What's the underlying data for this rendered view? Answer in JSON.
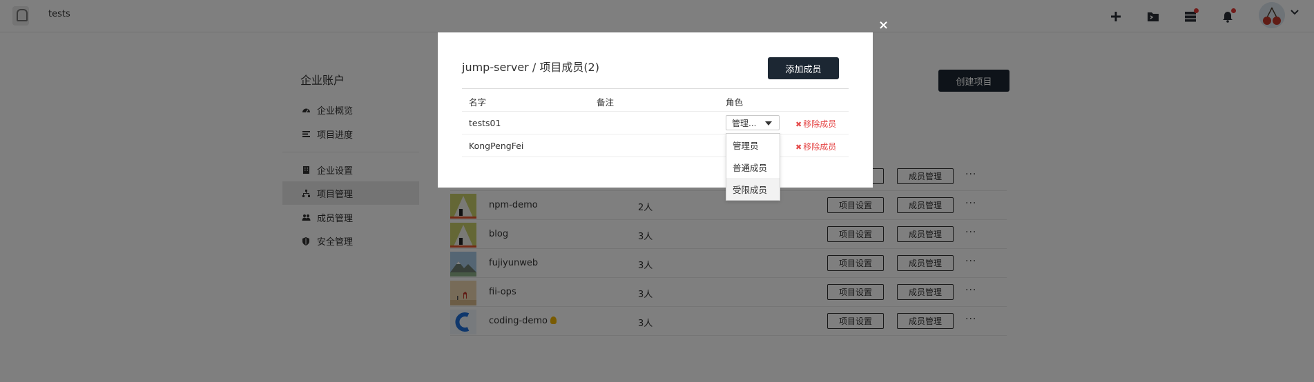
{
  "header": {
    "team_name": "tests",
    "icons": [
      "plus-icon",
      "terminal-icon",
      "tasks-icon",
      "bell-icon"
    ],
    "avatar_icon": "cherry-avatar-icon"
  },
  "sidebar": {
    "title": "企业账户",
    "items": [
      {
        "label": "企业概览",
        "icon": "dashboard-icon"
      },
      {
        "label": "项目进度",
        "icon": "progress-icon"
      },
      {
        "label": "企业设置",
        "icon": "building-icon"
      },
      {
        "label": "项目管理",
        "icon": "sitemap-icon",
        "active": true
      },
      {
        "label": "成员管理",
        "icon": "users-icon"
      },
      {
        "label": "安全管理",
        "icon": "shield-icon"
      }
    ]
  },
  "main": {
    "create_label": "创建项目",
    "projects": [
      {
        "name": "",
        "count": "",
        "settings": "项目设置",
        "members": "成员管理",
        "more": "···"
      },
      {
        "name": "npm-demo",
        "count": "2人",
        "settings": "项目设置",
        "members": "成员管理",
        "more": "···"
      },
      {
        "name": "blog",
        "count": "3人",
        "settings": "项目设置",
        "members": "成员管理",
        "more": "···"
      },
      {
        "name": "fujiyunweb",
        "count": "3人",
        "settings": "项目设置",
        "members": "成员管理",
        "more": "···"
      },
      {
        "name": "fii-ops",
        "count": "3人",
        "settings": "项目设置",
        "members": "成员管理",
        "more": "···"
      },
      {
        "name": "coding-demo",
        "count": "3人",
        "settings": "项目设置",
        "members": "成员管理",
        "more": "···"
      }
    ]
  },
  "modal": {
    "title": "jump-server / 项目成员(2)",
    "add_label": "添加成员",
    "close": "×",
    "headers": {
      "name": "名字",
      "note": "备注",
      "role": "角色"
    },
    "members": [
      {
        "name": "tests01",
        "note": "",
        "role": "管理...",
        "remove": "移除成员"
      },
      {
        "name": "KongPengFei",
        "note": "",
        "role": "",
        "remove": "移除成员"
      }
    ],
    "role_options": [
      "管理员",
      "普通成员",
      "受限成员"
    ]
  }
}
